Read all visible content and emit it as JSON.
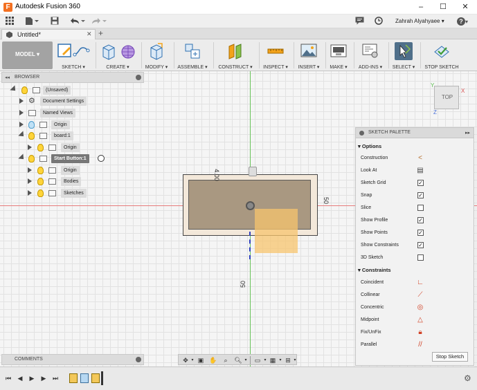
{
  "window": {
    "title": "Autodesk Fusion 360",
    "logo": "F",
    "minimize": "–",
    "maximize": "☐",
    "close": "✕"
  },
  "qat": {
    "user_name": "Zahrah Alyahyaee ▾",
    "help": "?"
  },
  "tab": {
    "name": "Untitled*",
    "close": "✕",
    "add": "+"
  },
  "ribbon": {
    "workspace": "MODEL ▾",
    "groups": [
      {
        "label": "SKETCH ▾"
      },
      {
        "label": "CREATE ▾"
      },
      {
        "label": "MODIFY ▾"
      },
      {
        "label": "ASSEMBLE ▾"
      },
      {
        "label": "CONSTRUCT ▾"
      },
      {
        "label": "INSPECT ▾"
      },
      {
        "label": "INSERT ▾"
      },
      {
        "label": "MAKE ▾"
      },
      {
        "label": "ADD-INS ▾"
      },
      {
        "label": "SELECT ▾"
      },
      {
        "label": "STOP SKETCH"
      }
    ]
  },
  "browser": {
    "title": "BROWSER",
    "items": [
      {
        "label": "(Unsaved)"
      },
      {
        "label": "Document Settings"
      },
      {
        "label": "Named Views"
      },
      {
        "label": "Origin"
      },
      {
        "label": "board:1"
      },
      {
        "label": "Origin"
      },
      {
        "label": "Start Button:1"
      },
      {
        "label": "Origin"
      },
      {
        "label": "Bodies"
      },
      {
        "label": "Sketches"
      }
    ]
  },
  "canvas": {
    "dim_top": "4.00",
    "dim_right": "50",
    "dim_bottom": "50",
    "viewcube": "TOP",
    "axis_y": "Y",
    "axis_x": "X",
    "axis_z": "Z"
  },
  "palette": {
    "title": "SKETCH PALETTE",
    "options_heading": "Options",
    "options": [
      {
        "label": "Construction"
      },
      {
        "label": "Look At"
      },
      {
        "label": "Sketch Grid"
      },
      {
        "label": "Snap"
      },
      {
        "label": "Slice"
      },
      {
        "label": "Show Profile"
      },
      {
        "label": "Show Points"
      },
      {
        "label": "Show Constraints"
      },
      {
        "label": "3D Sketch"
      }
    ],
    "constraints_heading": "Constraints",
    "constraints": [
      {
        "label": "Coincident"
      },
      {
        "label": "Collinear"
      },
      {
        "label": "Concentric"
      },
      {
        "label": "Midpoint"
      },
      {
        "label": "Fix/UnFix"
      },
      {
        "label": "Parallel"
      }
    ],
    "stop_button": "Stop Sketch"
  },
  "comments": {
    "label": "COMMENTS"
  }
}
